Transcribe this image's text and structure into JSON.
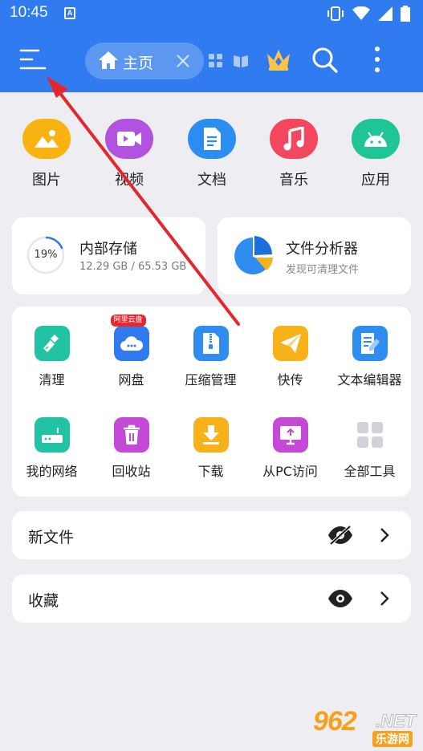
{
  "status_bar": {
    "time": "10:45",
    "notif": "A"
  },
  "app_bar": {
    "tab_label": "主页",
    "icons": [
      "menu-icon",
      "home-icon",
      "close-icon",
      "tabs-grid-icon",
      "book-icon",
      "crown-icon",
      "search-icon",
      "more-vert-icon"
    ]
  },
  "categories": [
    {
      "label": "图片",
      "icon": "image-icon",
      "color": "#f9b310"
    },
    {
      "label": "视频",
      "icon": "video-icon",
      "color": "#b253e0"
    },
    {
      "label": "文档",
      "icon": "document-icon",
      "color": "#2b8df2"
    },
    {
      "label": "音乐",
      "icon": "music-icon",
      "color": "#f2475e"
    },
    {
      "label": "应用",
      "icon": "android-icon",
      "color": "#1fc596"
    }
  ],
  "storage": {
    "percent_text": "19%",
    "percent": 19,
    "title": "内部存储",
    "usage": "12.29 GB / 65.53 GB"
  },
  "analyzer": {
    "title": "文件分析器",
    "subtitle": "发现可清理文件"
  },
  "tools": [
    {
      "label": "清理",
      "icon": "broom-icon",
      "color": "#22c2a5"
    },
    {
      "label": "网盘",
      "icon": "cloud-icon",
      "color": "#2f7bef",
      "badge": "阿里云盘"
    },
    {
      "label": "压缩管理",
      "icon": "zip-icon",
      "color": "#2f8cf0"
    },
    {
      "label": "快传",
      "icon": "send-icon",
      "color": "#f7b21a"
    },
    {
      "label": "文本编辑器",
      "icon": "edit-note-icon",
      "color": "#2f8cf0"
    },
    {
      "label": "我的网络",
      "icon": "router-icon",
      "color": "#22c2a5"
    },
    {
      "label": "回收站",
      "icon": "trash-icon",
      "color": "#c449d6"
    },
    {
      "label": "下载",
      "icon": "download-icon",
      "color": "#f7b21a"
    },
    {
      "label": "从PC访问",
      "icon": "pc-access-icon",
      "color": "#c449d6"
    },
    {
      "label": "全部工具",
      "icon": "all-tools-icon",
      "color": "#cfd2d8"
    }
  ],
  "sections": [
    {
      "label": "新文件",
      "eye": "eye-off-icon"
    },
    {
      "label": "收藏",
      "eye": "eye-icon"
    }
  ],
  "watermark": {
    "brand": "962",
    "net": ".NET",
    "sub": "乐游网"
  }
}
